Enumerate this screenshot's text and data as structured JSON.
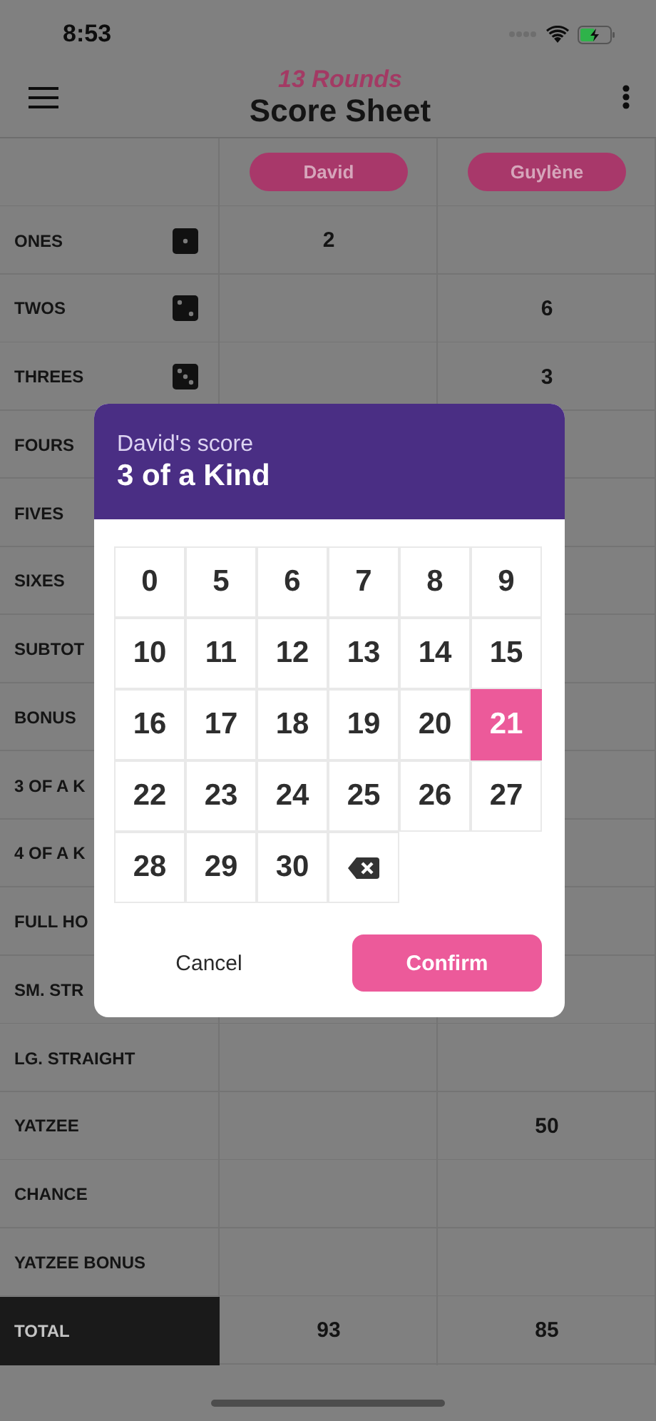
{
  "status_bar": {
    "time": "8:53"
  },
  "header": {
    "subtitle": "13 Rounds",
    "title": "Score Sheet"
  },
  "players": [
    {
      "name": "David"
    },
    {
      "name": "Guylène"
    }
  ],
  "rows": [
    {
      "label": "ONES",
      "kind": "ones",
      "column_1": "2"
    },
    {
      "label": "TWOS",
      "kind": "twos",
      "column_2": "6"
    },
    {
      "label": "THREES",
      "kind": "threes",
      "column_2": "3"
    },
    {
      "label": "FOURS",
      "kind": "plain"
    },
    {
      "label": "FIVES",
      "kind": "plain"
    },
    {
      "label": "SIXES",
      "kind": "plain"
    },
    {
      "label": "SUBTOT",
      "kind": "plain"
    },
    {
      "label": "BONUS",
      "kind": "plain"
    },
    {
      "label": "3 OF A K",
      "kind": "plain"
    },
    {
      "label": "4 OF A K",
      "kind": "plain"
    },
    {
      "label": "FULL HO",
      "kind": "plain"
    },
    {
      "label": "SM. STR",
      "kind": "plain"
    },
    {
      "label": "LG. STRAIGHT",
      "kind": "plain"
    },
    {
      "label": "YATZEE",
      "kind": "plain",
      "column_2": "50"
    },
    {
      "label": "CHANCE",
      "kind": "plain"
    },
    {
      "label": "YATZEE BONUS",
      "kind": "plain"
    },
    {
      "label": "TOTAL",
      "kind": "total",
      "column_1": "93",
      "column_2": "85"
    }
  ],
  "dialog": {
    "caption": "David's score",
    "title": "3 of a Kind",
    "keys": [
      {
        "kind": "number",
        "label": "0",
        "selected": false
      },
      {
        "kind": "number",
        "label": "5",
        "selected": false
      },
      {
        "kind": "number",
        "label": "6",
        "selected": false
      },
      {
        "kind": "number",
        "label": "7",
        "selected": false
      },
      {
        "kind": "number",
        "label": "8",
        "selected": false
      },
      {
        "kind": "number",
        "label": "9",
        "selected": false
      },
      {
        "kind": "number",
        "label": "10",
        "selected": false
      },
      {
        "kind": "number",
        "label": "11",
        "selected": false
      },
      {
        "kind": "number",
        "label": "12",
        "selected": false
      },
      {
        "kind": "number",
        "label": "13",
        "selected": false
      },
      {
        "kind": "number",
        "label": "14",
        "selected": false
      },
      {
        "kind": "number",
        "label": "15",
        "selected": false
      },
      {
        "kind": "number",
        "label": "16",
        "selected": false
      },
      {
        "kind": "number",
        "label": "17",
        "selected": false
      },
      {
        "kind": "number",
        "label": "18",
        "selected": false
      },
      {
        "kind": "number",
        "label": "19",
        "selected": false
      },
      {
        "kind": "number",
        "label": "20",
        "selected": false
      },
      {
        "kind": "number",
        "label": "21",
        "selected": true
      },
      {
        "kind": "number",
        "label": "22",
        "selected": false
      },
      {
        "kind": "number",
        "label": "23",
        "selected": false
      },
      {
        "kind": "number",
        "label": "24",
        "selected": false
      },
      {
        "kind": "number",
        "label": "25",
        "selected": false
      },
      {
        "kind": "number",
        "label": "26",
        "selected": false
      },
      {
        "kind": "number",
        "label": "27",
        "selected": false
      },
      {
        "kind": "number",
        "label": "28",
        "selected": false
      },
      {
        "kind": "number",
        "label": "29",
        "selected": false
      },
      {
        "kind": "number",
        "label": "30",
        "selected": false
      },
      {
        "kind": "backspace"
      }
    ],
    "buttons": [
      {
        "kind": "text",
        "label": "Cancel"
      },
      {
        "kind": "primary",
        "label": "Confirm"
      }
    ]
  }
}
